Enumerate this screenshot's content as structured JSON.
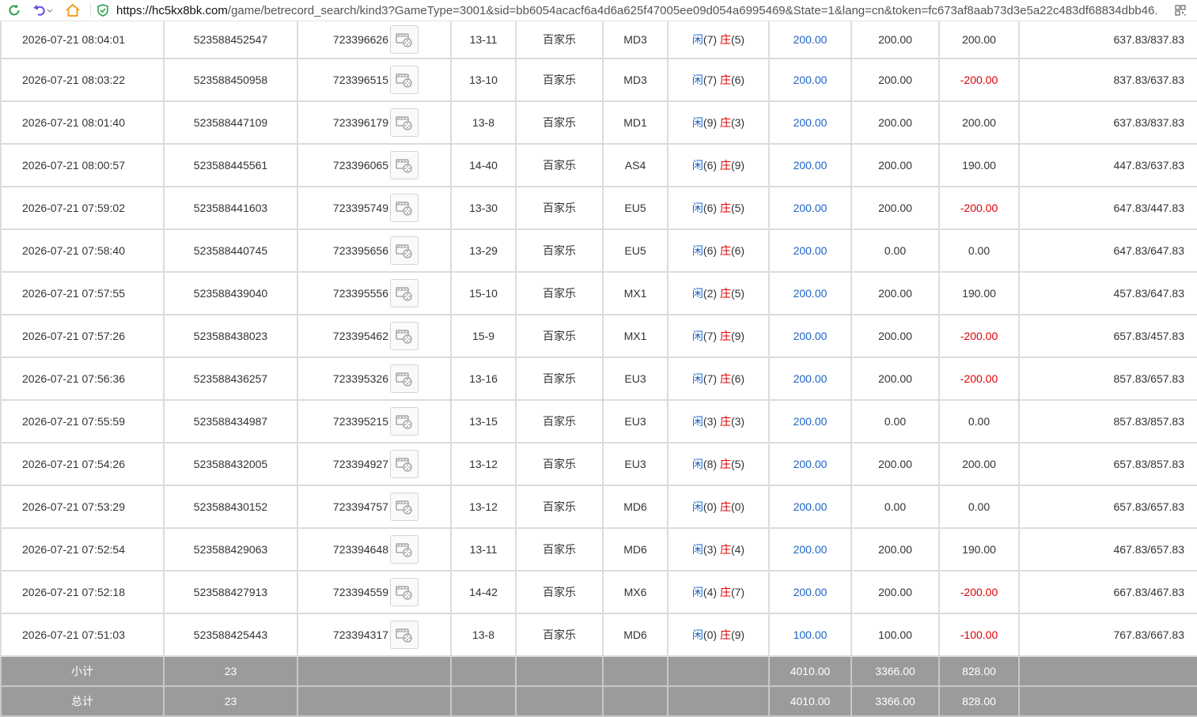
{
  "browser": {
    "url_host": "https://hc5kx8bk.com",
    "url_rest": "/game/betrecord_search/kind3?GameType=3001&sid=bb6054acacf6a4d6a625f47005ee09d054a6995469&State=1&lang=cn&token=fc673af8aab73d3e5a22c483df68834dbb46."
  },
  "labels": {
    "player": "闲",
    "banker": "庄"
  },
  "rows": [
    {
      "time": "2026-07-21 08:04:01",
      "bet_id": "523588452547",
      "round": "723396626",
      "shoe": "13-11",
      "game": "百家乐",
      "table": "MD3",
      "p": "(7)",
      "b": "(5)",
      "bet": "200.00",
      "valid": "200.00",
      "win": "200.00",
      "win_neg": false,
      "balance": "637.83/837.83"
    },
    {
      "time": "2026-07-21 08:03:22",
      "bet_id": "523588450958",
      "round": "723396515",
      "shoe": "13-10",
      "game": "百家乐",
      "table": "MD3",
      "p": "(7)",
      "b": "(6)",
      "bet": "200.00",
      "valid": "200.00",
      "win": "-200.00",
      "win_neg": true,
      "balance": "837.83/637.83"
    },
    {
      "time": "2026-07-21 08:01:40",
      "bet_id": "523588447109",
      "round": "723396179",
      "shoe": "13-8",
      "game": "百家乐",
      "table": "MD1",
      "p": "(9)",
      "b": "(3)",
      "bet": "200.00",
      "valid": "200.00",
      "win": "200.00",
      "win_neg": false,
      "balance": "637.83/837.83"
    },
    {
      "time": "2026-07-21 08:00:57",
      "bet_id": "523588445561",
      "round": "723396065",
      "shoe": "14-40",
      "game": "百家乐",
      "table": "AS4",
      "p": "(6)",
      "b": "(9)",
      "bet": "200.00",
      "valid": "200.00",
      "win": "190.00",
      "win_neg": false,
      "balance": "447.83/637.83"
    },
    {
      "time": "2026-07-21 07:59:02",
      "bet_id": "523588441603",
      "round": "723395749",
      "shoe": "13-30",
      "game": "百家乐",
      "table": "EU5",
      "p": "(6)",
      "b": "(5)",
      "bet": "200.00",
      "valid": "200.00",
      "win": "-200.00",
      "win_neg": true,
      "balance": "647.83/447.83"
    },
    {
      "time": "2026-07-21 07:58:40",
      "bet_id": "523588440745",
      "round": "723395656",
      "shoe": "13-29",
      "game": "百家乐",
      "table": "EU5",
      "p": "(6)",
      "b": "(6)",
      "bet": "200.00",
      "valid": "0.00",
      "win": "0.00",
      "win_neg": false,
      "balance": "647.83/647.83"
    },
    {
      "time": "2026-07-21 07:57:55",
      "bet_id": "523588439040",
      "round": "723395556",
      "shoe": "15-10",
      "game": "百家乐",
      "table": "MX1",
      "p": "(2)",
      "b": "(5)",
      "bet": "200.00",
      "valid": "200.00",
      "win": "190.00",
      "win_neg": false,
      "balance": "457.83/647.83"
    },
    {
      "time": "2026-07-21 07:57:26",
      "bet_id": "523588438023",
      "round": "723395462",
      "shoe": "15-9",
      "game": "百家乐",
      "table": "MX1",
      "p": "(7)",
      "b": "(9)",
      "bet": "200.00",
      "valid": "200.00",
      "win": "-200.00",
      "win_neg": true,
      "balance": "657.83/457.83"
    },
    {
      "time": "2026-07-21 07:56:36",
      "bet_id": "523588436257",
      "round": "723395326",
      "shoe": "13-16",
      "game": "百家乐",
      "table": "EU3",
      "p": "(7)",
      "b": "(6)",
      "bet": "200.00",
      "valid": "200.00",
      "win": "-200.00",
      "win_neg": true,
      "balance": "857.83/657.83"
    },
    {
      "time": "2026-07-21 07:55:59",
      "bet_id": "523588434987",
      "round": "723395215",
      "shoe": "13-15",
      "game": "百家乐",
      "table": "EU3",
      "p": "(3)",
      "b": "(3)",
      "bet": "200.00",
      "valid": "0.00",
      "win": "0.00",
      "win_neg": false,
      "balance": "857.83/857.83"
    },
    {
      "time": "2026-07-21 07:54:26",
      "bet_id": "523588432005",
      "round": "723394927",
      "shoe": "13-12",
      "game": "百家乐",
      "table": "EU3",
      "p": "(8)",
      "b": "(5)",
      "bet": "200.00",
      "valid": "200.00",
      "win": "200.00",
      "win_neg": false,
      "balance": "657.83/857.83"
    },
    {
      "time": "2026-07-21 07:53:29",
      "bet_id": "523588430152",
      "round": "723394757",
      "shoe": "13-12",
      "game": "百家乐",
      "table": "MD6",
      "p": "(0)",
      "b": "(0)",
      "bet": "200.00",
      "valid": "0.00",
      "win": "0.00",
      "win_neg": false,
      "balance": "657.83/657.83"
    },
    {
      "time": "2026-07-21 07:52:54",
      "bet_id": "523588429063",
      "round": "723394648",
      "shoe": "13-11",
      "game": "百家乐",
      "table": "MD6",
      "p": "(3)",
      "b": "(4)",
      "bet": "200.00",
      "valid": "200.00",
      "win": "190.00",
      "win_neg": false,
      "balance": "467.83/657.83"
    },
    {
      "time": "2026-07-21 07:52:18",
      "bet_id": "523588427913",
      "round": "723394559",
      "shoe": "14-42",
      "game": "百家乐",
      "table": "MX6",
      "p": "(4)",
      "b": "(7)",
      "bet": "200.00",
      "valid": "200.00",
      "win": "-200.00",
      "win_neg": true,
      "balance": "667.83/467.83"
    },
    {
      "time": "2026-07-21 07:51:03",
      "bet_id": "523588425443",
      "round": "723394317",
      "shoe": "13-8",
      "game": "百家乐",
      "table": "MD6",
      "p": "(0)",
      "b": "(9)",
      "bet": "100.00",
      "valid": "100.00",
      "win": "-100.00",
      "win_neg": true,
      "balance": "767.83/667.83"
    }
  ],
  "subtotal": {
    "label": "小计",
    "count": "23",
    "bet": "4010.00",
    "valid": "3366.00",
    "win": "828.00"
  },
  "total": {
    "label": "总计",
    "count": "23",
    "bet": "4010.00",
    "valid": "3366.00",
    "win": "828.00"
  },
  "colors": {
    "blue": "#1a64c8",
    "red": "#e00000",
    "summary_bg": "#9b9b9b"
  }
}
